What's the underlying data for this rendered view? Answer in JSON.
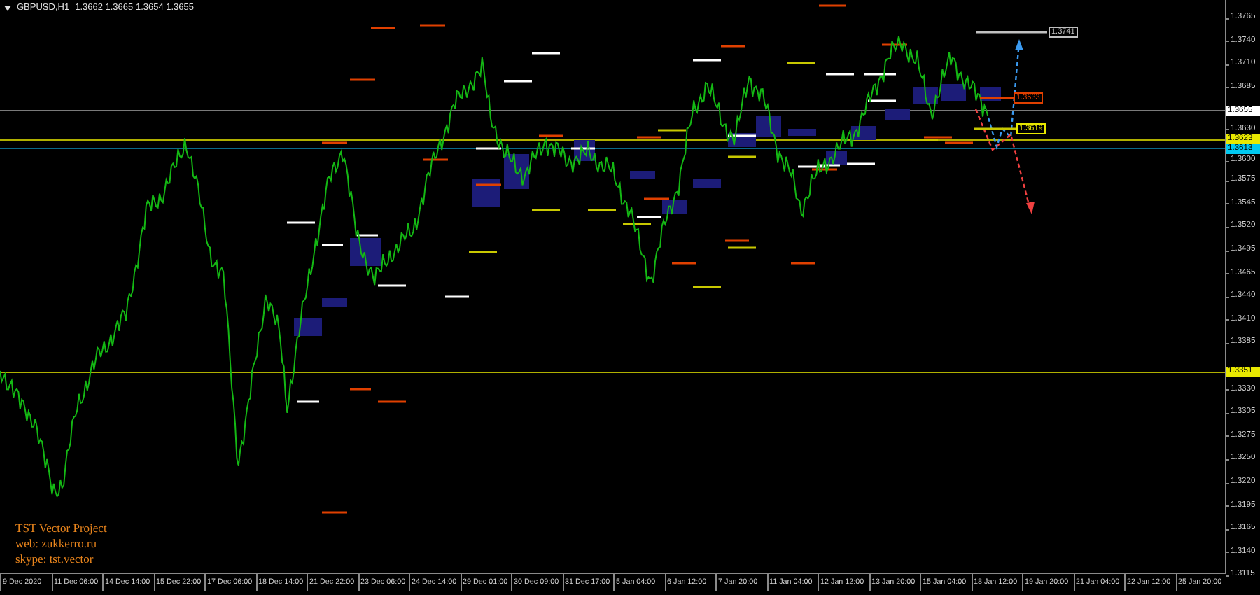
{
  "chart_header": {
    "symbol": "GBPUSD,H1",
    "quotes": "1.3662 1.3665 1.3654 1.3655"
  },
  "price_axis": {
    "ticks": [
      "1.3765",
      "1.3740",
      "1.3710",
      "1.3685",
      "1.3630",
      "1.3600",
      "1.3575",
      "1.3545",
      "1.3520",
      "1.3495",
      "1.3465",
      "1.3440",
      "1.3410",
      "1.3385",
      "1.3330",
      "1.3305",
      "1.3275",
      "1.3250",
      "1.3220",
      "1.3195",
      "1.3165",
      "1.3140",
      "1.3115"
    ],
    "tags": [
      {
        "label": "1.3655",
        "color": "#ffffff"
      },
      {
        "label": "1.3623",
        "color": "#e8e800"
      },
      {
        "label": "1.3613",
        "color": "#00c8f0"
      },
      {
        "label": "1.3351",
        "color": "#e8e800"
      }
    ]
  },
  "chart_tags": [
    {
      "label": "1.3741",
      "color": "#c0c0c0"
    },
    {
      "label": "1.3633",
      "color": "#e04000"
    },
    {
      "label": "1.3619",
      "color": "#e8e800"
    }
  ],
  "info_lines": [
    "TST Vector Project",
    "web: zukkerro.ru",
    "skype: tst.vector"
  ],
  "time_axis": [
    "9 Dec 2020",
    "11 Dec 06:00",
    "14 Dec 14:00",
    "15 Dec 22:00",
    "17 Dec 06:00",
    "18 Dec 14:00",
    "21 Dec 22:00",
    "23 Dec 06:00",
    "24 Dec 14:00",
    "29 Dec 01:00",
    "30 Dec 09:00",
    "31 Dec 17:00",
    "5 Jan 04:00",
    "6 Jan 12:00",
    "7 Jan 20:00",
    "11 Jan 04:00",
    "12 Jan 12:00",
    "13 Jan 20:00",
    "15 Jan 04:00",
    "18 Jan 12:00",
    "19 Jan 20:00",
    "21 Jan 04:00",
    "22 Jan 12:00",
    "25 Jan 20:00"
  ]
}
